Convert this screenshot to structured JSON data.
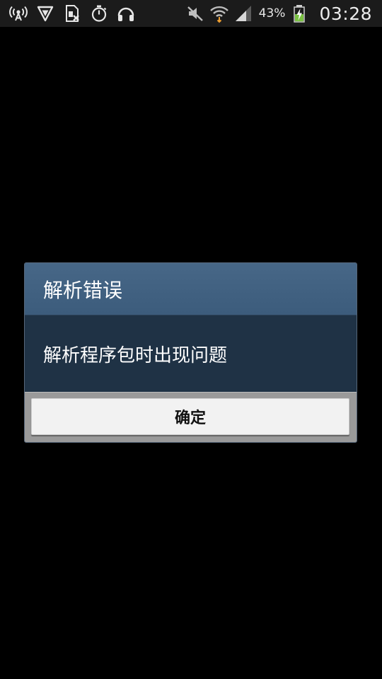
{
  "status_bar": {
    "left_icons": [
      "portable-hotspot-icon",
      "vpn-shield-icon",
      "no-sim-icon",
      "stopwatch-icon",
      "headphones-icon"
    ],
    "right_icons": [
      "mute-icon",
      "wifi-icon",
      "signal-icon",
      "battery-charging-icon"
    ],
    "battery_percent": "43%",
    "time": "03:28"
  },
  "dialog": {
    "title": "解析错误",
    "message": "解析程序包时出现问题",
    "ok_label": "确定"
  },
  "colors": {
    "title_bar": "#446484",
    "message_bg": "#1f3245",
    "button_area": "#9a9a9a",
    "button_face": "#f2f2f2",
    "battery_charge": "#7ac142",
    "wifi_arrow": "#f0a030"
  }
}
